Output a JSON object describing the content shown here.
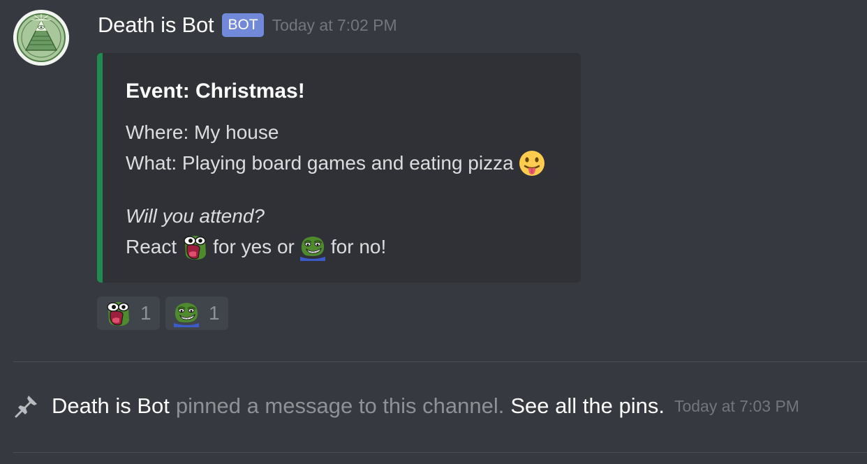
{
  "message": {
    "author": "Death is Bot",
    "bot_tag": "BOT",
    "timestamp": "Today at 7:02 PM",
    "avatar_icon": "illuminati-pyramid-icon"
  },
  "embed": {
    "accent_color": "#1f8b4c",
    "title": "Event: Christmas!",
    "where": "Where: My house",
    "what": "What: Playing board games and eating pizza",
    "what_emoji": "stuck-out-tongue-emoji",
    "question": "Will you attend?",
    "react_prefix": "React",
    "react_yes": "for yes or",
    "react_no": "for no!",
    "yes_emoji": "pepe-excited-emoji",
    "no_emoji": "pepe-grin-emoji"
  },
  "reactions": [
    {
      "emoji": "pepe-excited-emoji",
      "count": "1"
    },
    {
      "emoji": "pepe-grin-emoji",
      "count": "1"
    }
  ],
  "system_message": {
    "icon": "pin-icon",
    "user": "Death is Bot",
    "text": "pinned a message to this channel.",
    "link": "See all the pins.",
    "timestamp": "Today at 7:03 PM"
  },
  "colors": {
    "background": "#36393f",
    "embed_background": "#2f3136",
    "bot_tag": "#7289da",
    "muted_text": "#72767d"
  }
}
